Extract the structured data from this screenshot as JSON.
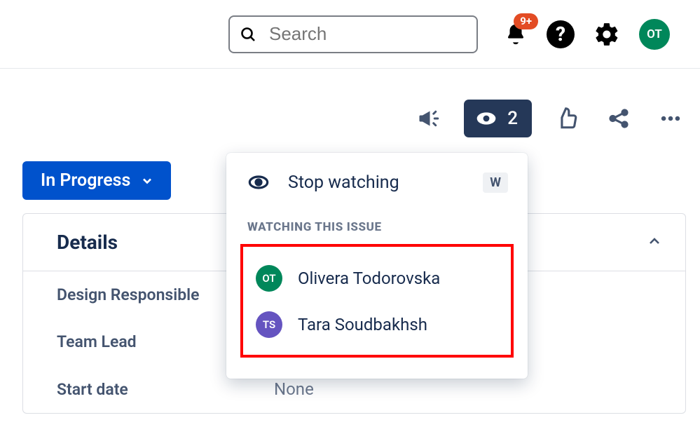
{
  "header": {
    "search_placeholder": "Search",
    "notifications_badge": "9+",
    "avatar_initials": "OT"
  },
  "actions": {
    "watch_count": "2"
  },
  "status": {
    "label": "In Progress"
  },
  "details": {
    "title": "Details",
    "fields": [
      {
        "label": "Design Responsible",
        "value": ""
      },
      {
        "label": "Team Lead",
        "value": ""
      },
      {
        "label": "Start date",
        "value": "None"
      }
    ]
  },
  "watchers_popover": {
    "toggle_label": "Stop watching",
    "shortcut": "W",
    "section_title": "WATCHING THIS ISSUE",
    "watchers": [
      {
        "initials": "OT",
        "name": "Olivera Todorovska",
        "color": "#00875A"
      },
      {
        "initials": "TS",
        "name": "Tara Soudbakhsh",
        "color": "#6554C0"
      }
    ]
  }
}
